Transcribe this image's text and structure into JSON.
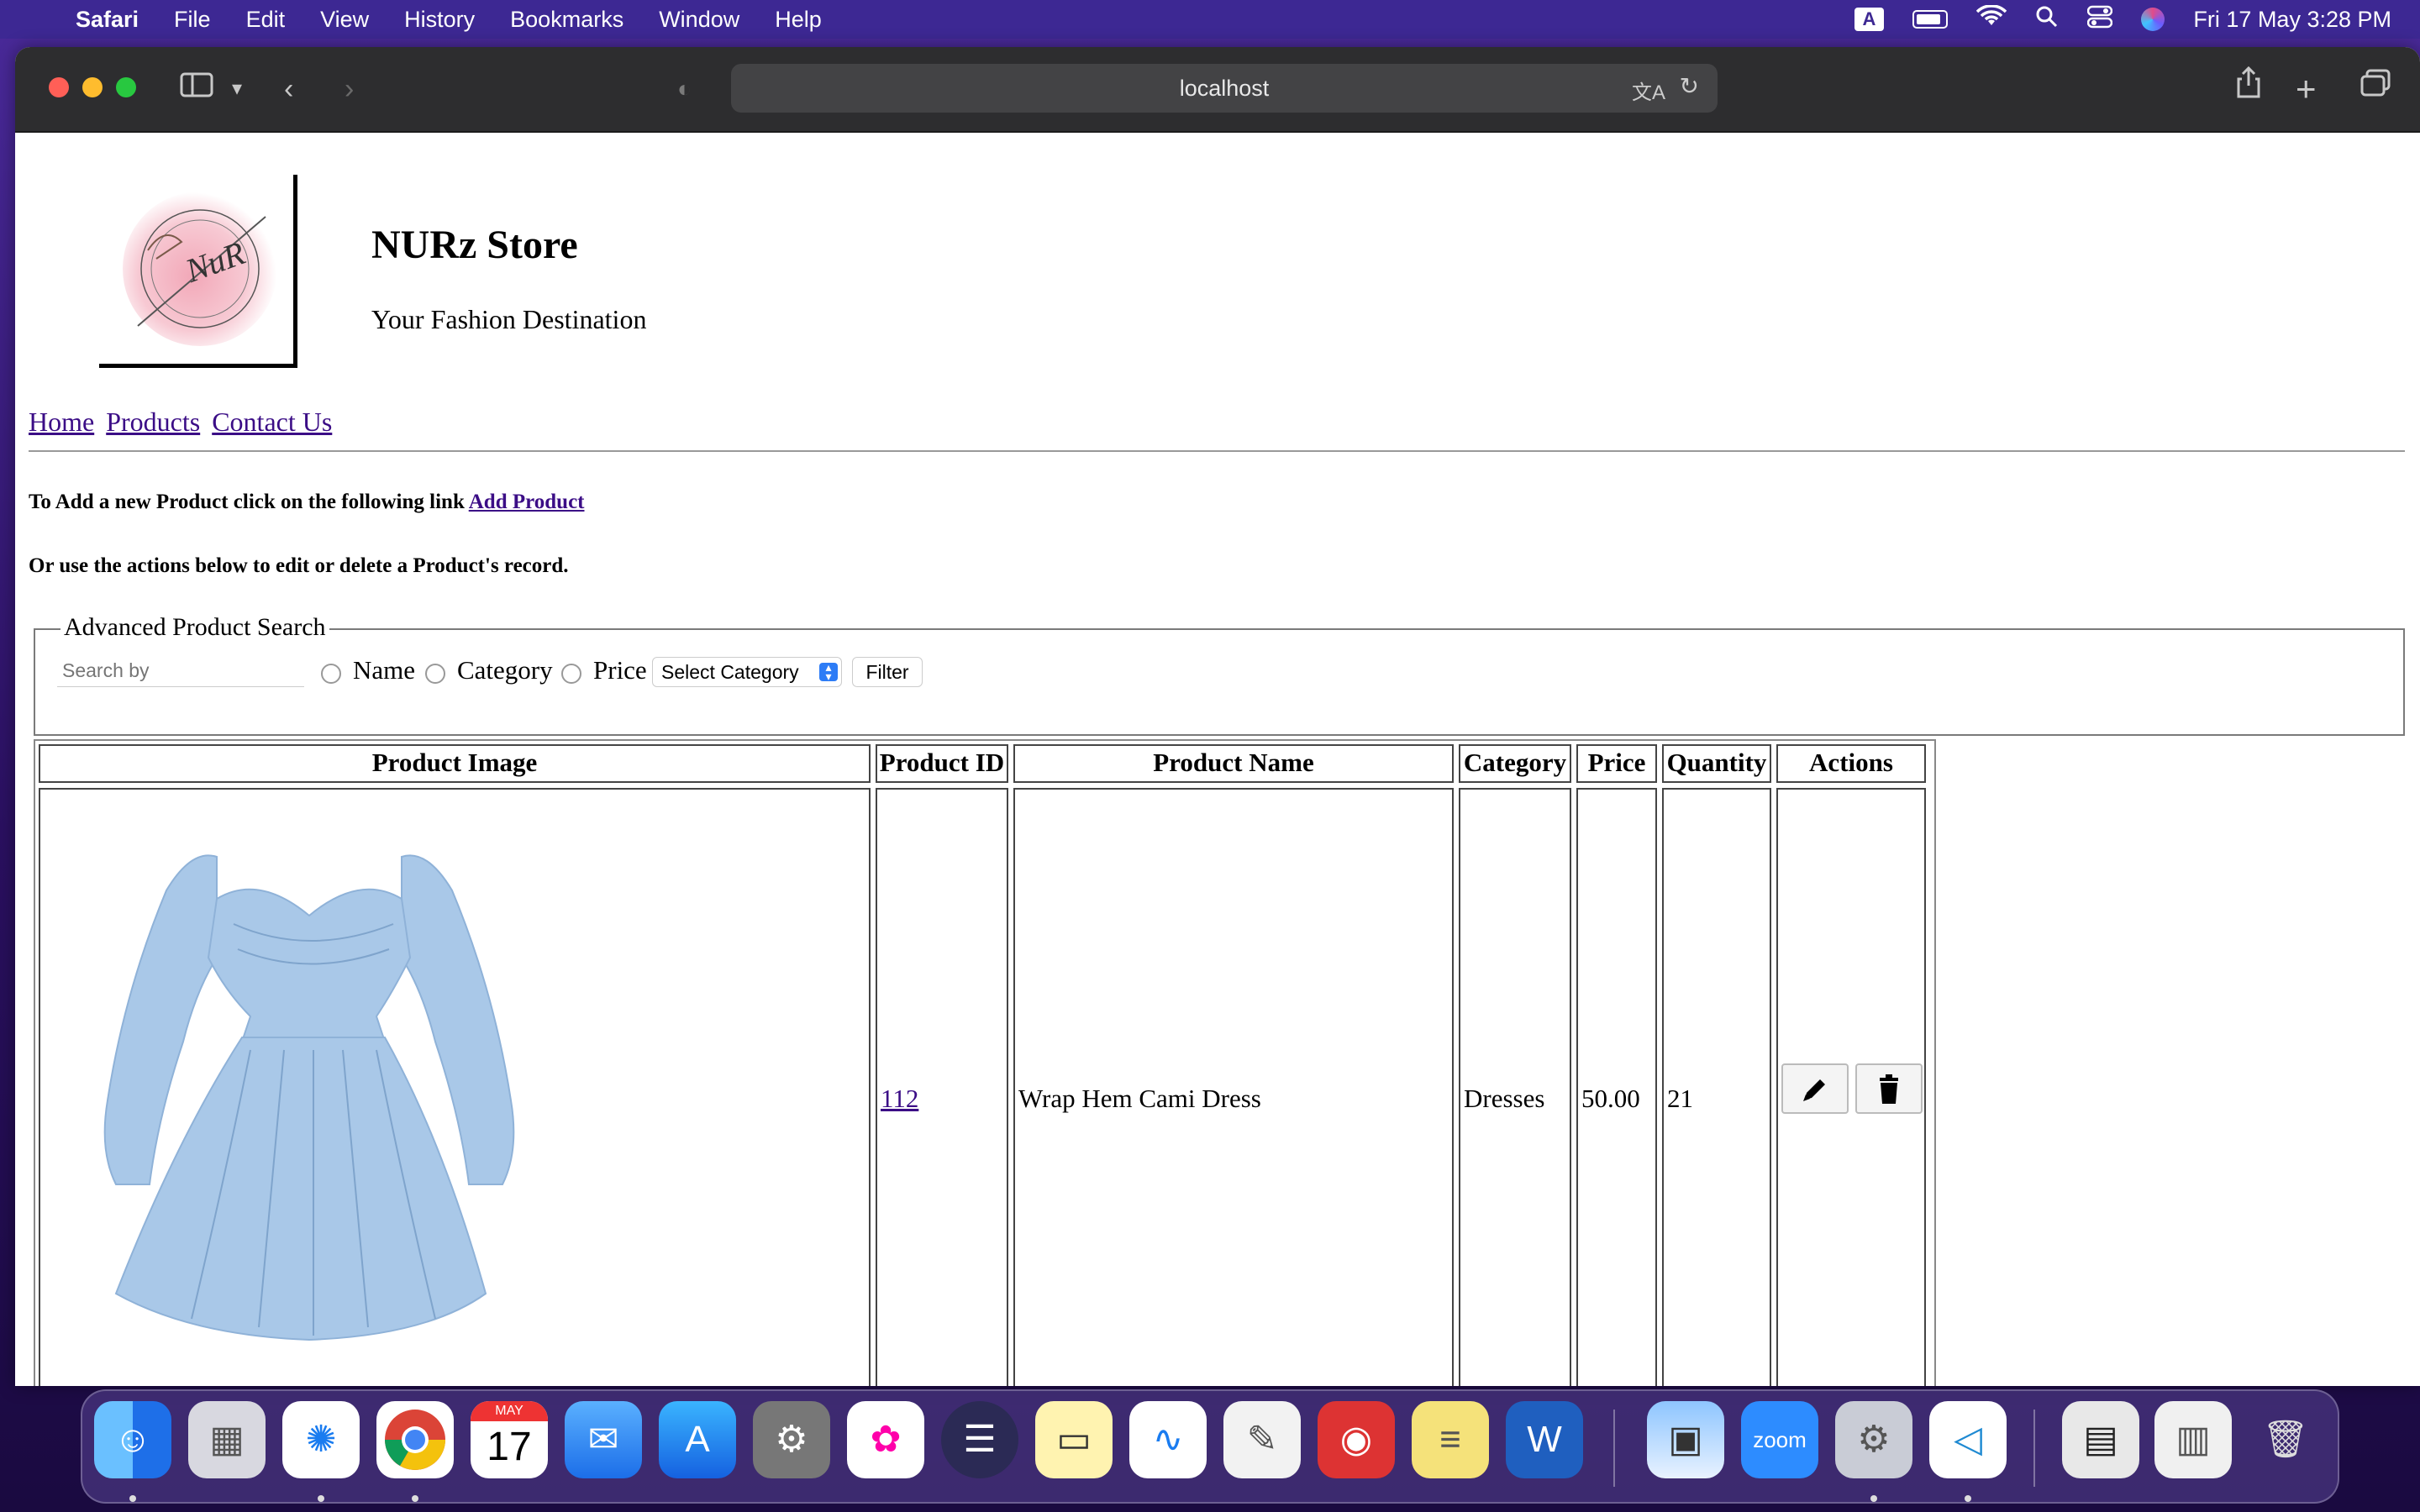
{
  "menubar": {
    "app_name": "Safari",
    "items": [
      "File",
      "Edit",
      "View",
      "History",
      "Bookmarks",
      "Window",
      "Help"
    ],
    "input_indicator": "A",
    "datetime": "Fri 17 May  3:28 PM"
  },
  "browser": {
    "url": "localhost"
  },
  "store": {
    "title": "NURz Store",
    "tagline": "Your Fashion Destination",
    "logo_text": "NuR"
  },
  "nav": {
    "home": "Home",
    "products": "Products",
    "contact": "Contact Us"
  },
  "intro": {
    "line1_prefix": "To Add a new Product click on the following link",
    "add_link": "Add Product",
    "line2": "Or use the actions below to edit or delete a Product's record."
  },
  "search": {
    "legend": "Advanced Product Search",
    "placeholder": "Search by",
    "radio_name": "Name",
    "radio_category": "Category",
    "radio_price": "Price",
    "select_value": "Select Category",
    "filter_label": "Filter"
  },
  "table": {
    "headers": {
      "image": "Product Image",
      "id": "Product ID",
      "name": "Product Name",
      "category": "Category",
      "price": "Price",
      "quantity": "Quantity",
      "actions": "Actions"
    },
    "rows": [
      {
        "id": "112",
        "name": "Wrap Hem Cami Dress",
        "category": "Dresses",
        "price": "50.00",
        "quantity": "21",
        "image_color": "#a9c8e8"
      }
    ]
  },
  "dock": {
    "calendar_month": "MAY",
    "calendar_day": "17",
    "zoom_label": "zoom"
  }
}
